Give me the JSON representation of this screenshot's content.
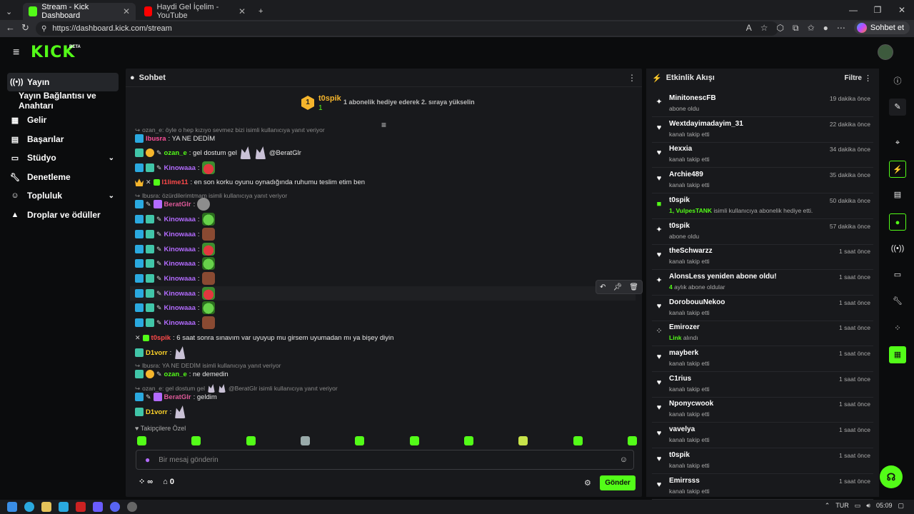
{
  "browser": {
    "tabs": [
      {
        "label": "Stream - Kick Dashboard",
        "color": "#53fc18"
      },
      {
        "label": "Haydi Gel İçelim - YouTube",
        "color": "#ff0000"
      }
    ],
    "url": "https://dashboard.kick.com/stream",
    "chat_button": "Sohbet et"
  },
  "header": {
    "logo": "KICK",
    "beta": "BETA"
  },
  "sidebar": {
    "items": [
      {
        "label": "Yayın",
        "icon": "broadcast-icon"
      },
      {
        "label": "Yayın Bağlantısı ve Anahtarı",
        "icon": ""
      },
      {
        "label": "Gelir",
        "icon": "revenue-icon"
      },
      {
        "label": "Başarılar",
        "icon": "achievements-icon"
      },
      {
        "label": "Stüdyo",
        "icon": "studio-icon"
      },
      {
        "label": "Denetleme",
        "icon": "moderation-icon"
      },
      {
        "label": "Topluluk",
        "icon": "community-icon"
      },
      {
        "label": "Droplar ve ödüller",
        "icon": "drops-icon"
      }
    ]
  },
  "chat": {
    "title": "Sohbet",
    "pinned": {
      "user": "t0spik",
      "count": "1",
      "rank": "1",
      "text": "1 abonelik hediye ederek 2. sıraya yükselin"
    },
    "reply1": "ozan_e: öyle o hep kızıyo sevmez bizi isimli kullanıcıya yanıt veriyor",
    "m1": {
      "user": "lbusra",
      "text": ": YA NE DEDİM"
    },
    "m2": {
      "user": "ozan_e",
      "text": ": gel dostum gel",
      "mention": "@BeratGlr"
    },
    "m3": {
      "user": "Kinowaaa",
      "text": ":"
    },
    "m4": {
      "user": "l1lime11",
      "text": ": en son korku oyunu oynadığında ruhumu teslim etim ben"
    },
    "reply2": "lbusra: özürdilerimtmam isimli kullanıcıya yanıt veriyor",
    "m5": {
      "user": "BeratGlr",
      "text": ":"
    },
    "kino": "Kinowaaa",
    "colon": ":",
    "m6": {
      "user": "t0spik",
      "text": ": 6 saat sonra sınavım var uyuyup mu girsem uyumadan mı ya bişey diyin"
    },
    "m7": {
      "user": "D1vorr",
      "text": ":"
    },
    "reply3": "lbusra: YA NE DEDİM isimli kullanıcıya yanıt veriyor",
    "m8": {
      "user": "ozan_e",
      "text": ": ne demedin"
    },
    "reply4": "ozan_e: gel dostum gel",
    "reply4b": "@BeratGlr isimli kullanıcıya yanıt veriyor",
    "m9": {
      "user": "BeratGlr",
      "text": ": geldim"
    },
    "m10": {
      "user": "D1vorr",
      "text": ":"
    },
    "followers_label": "Takipçilere Özel",
    "input_placeholder": "Bir mesaj gönderin",
    "footer_infinity": "∞",
    "footer_count": "0",
    "send": "Gönder"
  },
  "activity": {
    "title": "Etkinlik Akışı",
    "filter": "Filtre",
    "events": [
      {
        "name": "MinitonescFB",
        "sub": "abone oldu",
        "time": "19 dakika önce",
        "icon": "sparkle-icon"
      },
      {
        "name": "Wextdayimadayim_31",
        "sub": "kanalı takip etti",
        "time": "22 dakika önce",
        "icon": "heart-icon"
      },
      {
        "name": "Hexxia",
        "sub": "kanalı takip etti",
        "time": "34 dakika önce",
        "icon": "heart-icon"
      },
      {
        "name": "Archie489",
        "sub": "kanalı takip etti",
        "time": "35 dakika önce",
        "icon": "heart-icon"
      },
      {
        "name": "t0spik",
        "sub_hl": "1, VulpesTANK",
        "sub": " isimli kullanıcıya abonelik hediye etti.",
        "time": "50 dakika önce",
        "icon": "gift-icon"
      },
      {
        "name": "t0spik",
        "sub": "abone oldu",
        "time": "57 dakika önce",
        "icon": "sparkle-icon"
      },
      {
        "name": "theSchwarzz",
        "sub": "kanalı takip etti",
        "time": "1 saat önce",
        "icon": "heart-icon"
      },
      {
        "name": "AlonsLess yeniden abone oldu!",
        "sub_hl": "4",
        "sub": " aylık abone oldular",
        "time": "1 saat önce",
        "icon": "sparkle-icon"
      },
      {
        "name": "DorobouuNekoo",
        "sub": "kanalı takip etti",
        "time": "1 saat önce",
        "icon": "heart-icon"
      },
      {
        "name": "Emirozer",
        "sub_hl": "Link",
        "sub": " alındı",
        "time": "1 saat önce",
        "icon": "reward-icon"
      },
      {
        "name": "mayberk",
        "sub": "kanalı takip etti",
        "time": "1 saat önce",
        "icon": "heart-icon"
      },
      {
        "name": "C1rius",
        "sub": "kanalı takip etti",
        "time": "1 saat önce",
        "icon": "heart-icon"
      },
      {
        "name": "Nponycwook",
        "sub": "kanalı takip etti",
        "time": "1 saat önce",
        "icon": "heart-icon"
      },
      {
        "name": "vavelya",
        "sub": "kanalı takip etti",
        "time": "1 saat önce",
        "icon": "heart-icon"
      },
      {
        "name": "t0spik",
        "sub": "kanalı takip etti",
        "time": "1 saat önce",
        "icon": "heart-icon"
      },
      {
        "name": "Emirrsss",
        "sub": "kanalı takip etti",
        "time": "1 saat önce",
        "icon": "heart-icon"
      }
    ]
  },
  "taskbar": {
    "time": "05:09",
    "lang": "TUR"
  }
}
